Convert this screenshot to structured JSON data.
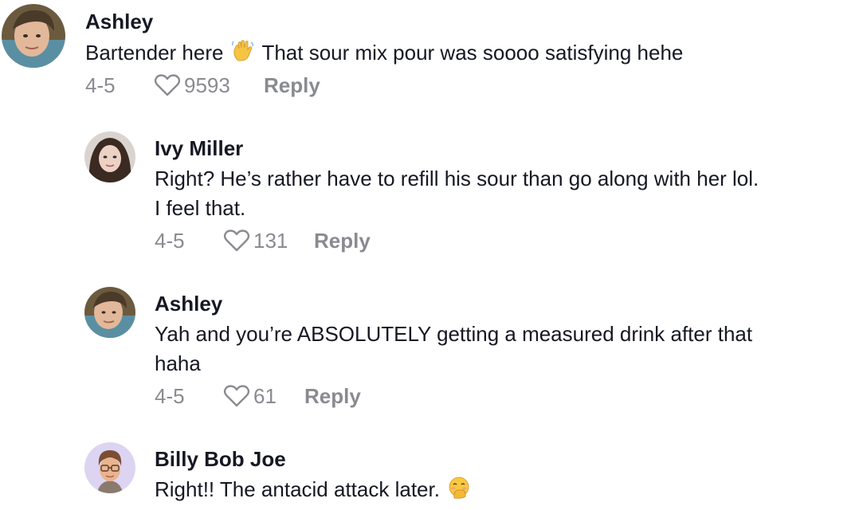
{
  "comments": [
    {
      "user": "Ashley",
      "text_before": "Bartender here",
      "emoji_icon": "waving-hand-icon",
      "text_after": "That sour mix pour was soooo satisfying hehe",
      "date": "4-5",
      "likes": "9593",
      "reply_label": "Reply"
    },
    {
      "user": "Ivy Miller",
      "text_line1": "Right? He’s rather have to refill his sour than go along with her lol.",
      "text_line2": "I feel that.",
      "date": "4-5",
      "likes": "131",
      "reply_label": "Reply"
    },
    {
      "user": "Ashley",
      "text_line1": "Yah and you’re ABSOLUTELY getting a measured drink after that",
      "text_line2": "haha",
      "date": "4-5",
      "likes": "61",
      "reply_label": "Reply"
    },
    {
      "user": "Billy Bob Joe",
      "text_before": "Right!! The antacid attack later.",
      "emoji_icon": "face-with-hand-over-mouth-icon"
    }
  ],
  "icons": {
    "like": "heart-outline-icon",
    "avatar": "user-avatar"
  },
  "colors": {
    "text": "#161823",
    "muted": "#8a8b91",
    "background": "#ffffff"
  }
}
